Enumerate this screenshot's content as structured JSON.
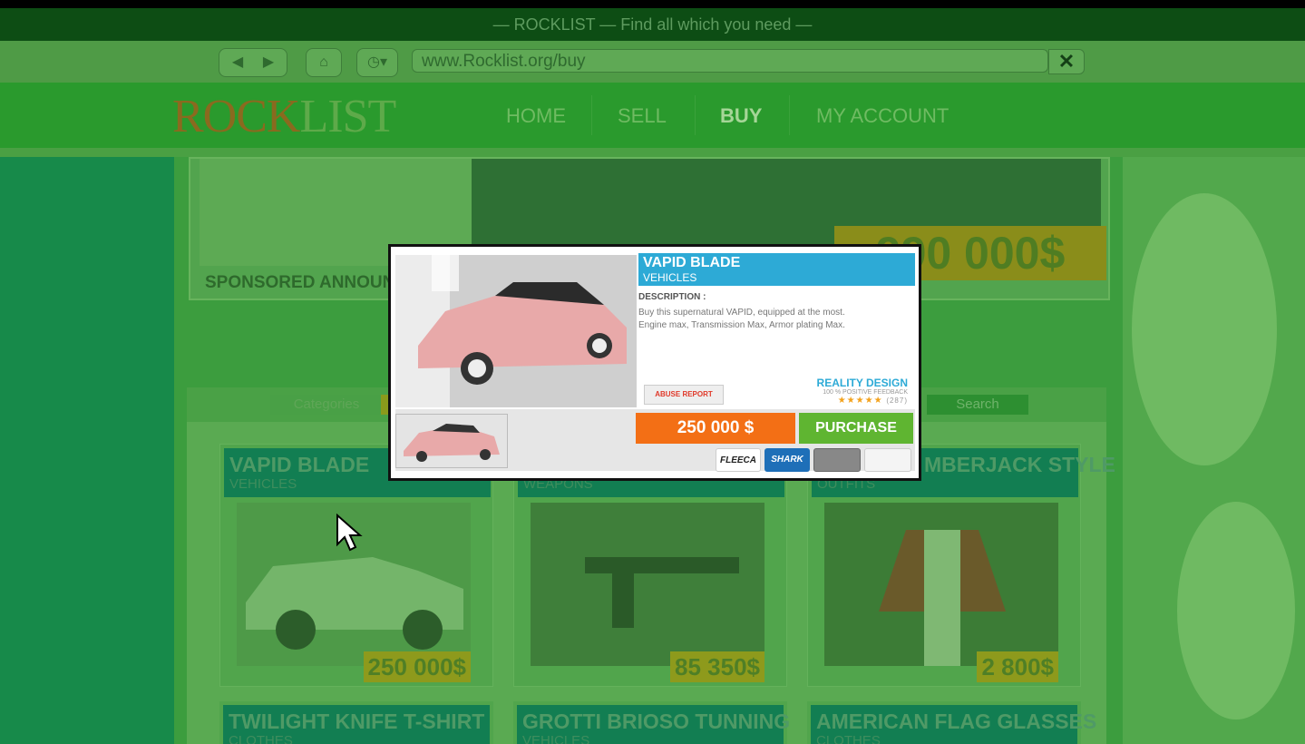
{
  "browser": {
    "title": "— ROCKLIST — Find all which you need —",
    "url": "www.Rocklist.org/buy",
    "close_label": "✕",
    "back_icon": "back-arrow-icon",
    "forward_icon": "forward-arrow-icon",
    "home_icon": "home-icon",
    "history_icon": "clock-icon"
  },
  "site": {
    "logo_part1": "ROCK",
    "logo_part2": "LIST",
    "menu": [
      {
        "label": "HOME"
      },
      {
        "label": "SELL"
      },
      {
        "label": "BUY"
      },
      {
        "label": "MY ACCOUNT"
      }
    ],
    "active_menu": "BUY"
  },
  "banner": {
    "sponsored_label": "SPONSORED ANNOUN",
    "price": "990 000$"
  },
  "filters": {
    "categories_label": "Categories",
    "search_label": "Search"
  },
  "listings": [
    {
      "title": "VAPID BLADE",
      "category": "VEHICLES",
      "price": "250 000$"
    },
    {
      "title": "",
      "category": "WEAPONS",
      "price": "85 350$"
    },
    {
      "title": "MBERJACK STYLE",
      "category": "OUTFITS",
      "price": "2 800$"
    },
    {
      "title": "TWILIGHT KNIFE T-SHIRT",
      "category": "CLOTHES"
    },
    {
      "title": "GROTTI BRIOSO TUNNING",
      "category": "VEHICLES"
    },
    {
      "title": "AMERICAN FLAG GLASSES",
      "category": "CLOTHES"
    }
  ],
  "modal": {
    "title": "VAPID BLADE",
    "category": "VEHICLES",
    "description_label": "DESCRIPTION :",
    "description_line1": "Buy this supernatural VAPID, equipped at the most.",
    "description_line2": "Engine max, Transmission Max, Armor plating Max.",
    "abuse_label": "ABUSE REPORT",
    "seller_name": "REALITY DESIGN",
    "seller_feedback": "100 % POSITIVE FEEDBACK",
    "rating_stars": "★★★★★",
    "rating_count": "(287)",
    "price": "250 000 $",
    "purchase_label": "PURCHASE",
    "payment_methods": [
      "FLEECA",
      "SHARK",
      "",
      ""
    ]
  },
  "colors": {
    "accent_blue": "#2daad6",
    "price_orange": "#f36f15",
    "purchase_green": "#5fb531"
  }
}
